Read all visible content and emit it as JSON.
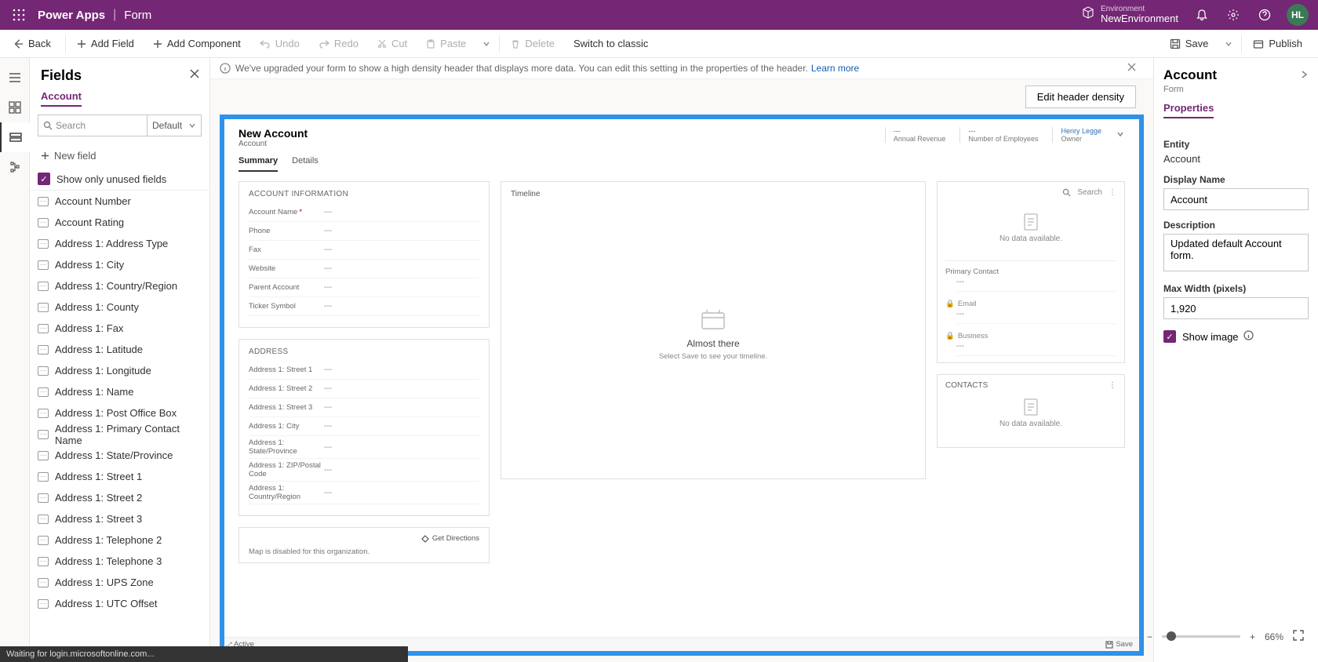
{
  "topbar": {
    "app": "Power Apps",
    "crumb": "Form",
    "env_label": "Environment",
    "env_name": "NewEnvironment",
    "avatar": "HL"
  },
  "cmdbar": {
    "back": "Back",
    "add_field": "Add Field",
    "add_component": "Add Component",
    "undo": "Undo",
    "redo": "Redo",
    "cut": "Cut",
    "paste": "Paste",
    "delete": "Delete",
    "switch_classic": "Switch to classic",
    "save": "Save",
    "publish": "Publish"
  },
  "fields": {
    "title": "Fields",
    "tab": "Account",
    "search_placeholder": "Search",
    "default_label": "Default",
    "new_field": "New field",
    "unused": "Show only unused fields",
    "items": [
      "Account Number",
      "Account Rating",
      "Address 1: Address Type",
      "Address 1: City",
      "Address 1: Country/Region",
      "Address 1: County",
      "Address 1: Fax",
      "Address 1: Latitude",
      "Address 1: Longitude",
      "Address 1: Name",
      "Address 1: Post Office Box",
      "Address 1: Primary Contact Name",
      "Address 1: State/Province",
      "Address 1: Street 1",
      "Address 1: Street 2",
      "Address 1: Street 3",
      "Address 1: Telephone 2",
      "Address 1: Telephone 3",
      "Address 1: UPS Zone",
      "Address 1: UTC Offset"
    ]
  },
  "notice": {
    "text": "We've upgraded your form to show a high density header that displays more data. You can edit this setting in the properties of the header.",
    "link": "Learn more"
  },
  "density_btn": "Edit header density",
  "form": {
    "title": "New Account",
    "subtitle": "Account",
    "header_stats": {
      "revenue_v": "---",
      "revenue_l": "Annual Revenue",
      "employees_v": "---",
      "employees_l": "Number of Employees",
      "owner_v": "Henry Legge",
      "owner_l": "Owner"
    },
    "tabs": {
      "summary": "Summary",
      "details": "Details"
    },
    "section1": {
      "title": "ACCOUNT INFORMATION",
      "fields": [
        {
          "label": "Account Name",
          "req": true
        },
        {
          "label": "Phone"
        },
        {
          "label": "Fax"
        },
        {
          "label": "Website"
        },
        {
          "label": "Parent Account"
        },
        {
          "label": "Ticker Symbol"
        }
      ]
    },
    "section2": {
      "title": "ADDRESS",
      "fields": [
        {
          "label": "Address 1: Street 1"
        },
        {
          "label": "Address 1: Street 2"
        },
        {
          "label": "Address 1: Street 3"
        },
        {
          "label": "Address 1: City"
        },
        {
          "label": "Address 1: State/Province"
        },
        {
          "label": "Address 1: ZIP/Postal Code"
        },
        {
          "label": "Address 1: Country/Region"
        }
      ]
    },
    "timeline": {
      "title": "Timeline",
      "msg1": "Almost there",
      "msg2": "Select Save to see your timeline."
    },
    "assist": {
      "search": "Search",
      "nodata": "No data available.",
      "primary_contact": "Primary Contact",
      "email": "Email",
      "business": "Business"
    },
    "contacts": {
      "title": "CONTACTS",
      "nodata": "No data available."
    },
    "map": {
      "get_directions": "Get Directions",
      "disabled": "Map is disabled for this organization."
    },
    "footer": {
      "status": "Active",
      "save": "Save"
    }
  },
  "props": {
    "title": "Account",
    "sub": "Form",
    "tab": "Properties",
    "entity_l": "Entity",
    "entity_v": "Account",
    "display_l": "Display Name",
    "display_v": "Account",
    "desc_l": "Description",
    "desc_v": "Updated default Account form.",
    "maxw_l": "Max Width (pixels)",
    "maxw_v": "1,920",
    "showimg": "Show image"
  },
  "statusbar": "Waiting for login.microsoftonline.com...",
  "zoom": {
    "pct": "66%"
  },
  "placeholder_dash": "---"
}
